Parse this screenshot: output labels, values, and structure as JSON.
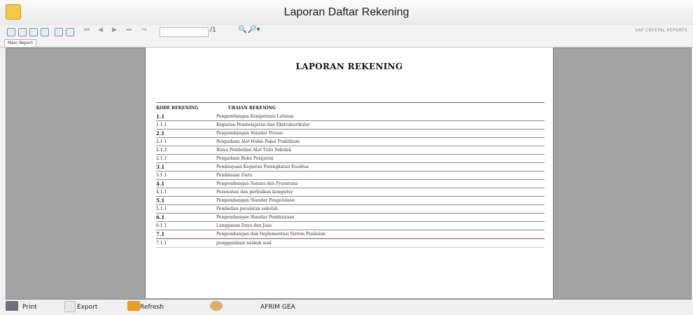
{
  "window": {
    "title": "Laporan Daftar Rekening"
  },
  "toolbar": {
    "page_of": "/1",
    "engine_label": "SAP CRYSTAL REPORTS"
  },
  "tabs": [
    {
      "label": "Main Report"
    }
  ],
  "report": {
    "title": "LAPORAN REKENING",
    "col_kode": "KODE REKENING",
    "col_uraian": "URAIAN REKENING",
    "rows": [
      {
        "kode": "1.1",
        "uraian": "Pengembangan Kompetensi Lulusan"
      },
      {
        "kode": "1.1.1",
        "uraian": "Kegiatan Pembelajaran dan Ekstrakurikuler"
      },
      {
        "kode": "2.1",
        "uraian": "Pengembangan Standar Proses"
      },
      {
        "kode": "2.1.1",
        "uraian": "Pengadaan Alat Habis Pakai Praktikum"
      },
      {
        "kode": "2.1.2",
        "uraian": "Biaya Pembelian Alat Tulis Sekolah"
      },
      {
        "kode": "2.1.1",
        "uraian": "Pengadaan Buku Pelajaran"
      },
      {
        "kode": "3.1",
        "uraian": "Pembiayaan Kegiatan Peningkatan Kualitas"
      },
      {
        "kode": "3.1.1",
        "uraian": "Pembinaan Guru"
      },
      {
        "kode": "4.1",
        "uraian": "Pengembangan Sarana dan Prasarana"
      },
      {
        "kode": "4.1.1",
        "uraian": "Perawatan dan perbaikan komputer"
      },
      {
        "kode": "5.1",
        "uraian": "Pengembangan Standar Pengelolaan"
      },
      {
        "kode": "5.1.1",
        "uraian": "Pembelian peralatan sekolah"
      },
      {
        "kode": "6.1",
        "uraian": "Pengembangan Standar Pembiayaan"
      },
      {
        "kode": "6.1.1",
        "uraian": "Langganan Daya dan Jasa"
      },
      {
        "kode": "7.1",
        "uraian": "Pengembangan dan Implementasi Sistem Penilaian"
      },
      {
        "kode": "7.1.1",
        "uraian": "penggandaan naskah soal"
      }
    ]
  },
  "bottombar": {
    "print": "Print",
    "export": "Export",
    "refresh": "Refresh",
    "user": "AFRIM GEA"
  },
  "colors": {
    "viewer_bg": "#a3a3a3",
    "page_bg": "#ffffff"
  }
}
